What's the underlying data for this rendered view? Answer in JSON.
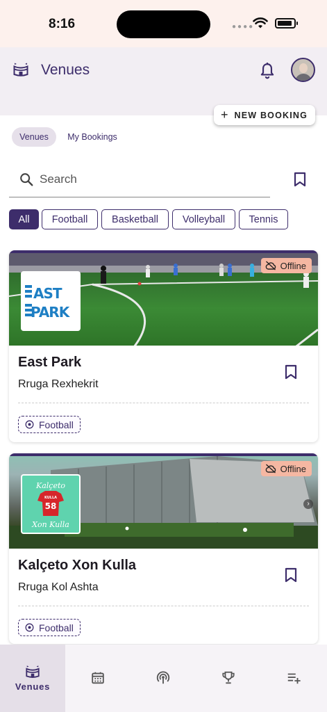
{
  "status_bar": {
    "time": "8:16"
  },
  "header": {
    "title": "Venues"
  },
  "new_booking": {
    "label": "NEW BOOKING"
  },
  "segments": [
    {
      "label": "Venues",
      "selected": true
    },
    {
      "label": "My Bookings",
      "selected": false
    }
  ],
  "search": {
    "placeholder": "Search",
    "value": ""
  },
  "filters": [
    {
      "label": "All",
      "selected": true
    },
    {
      "label": "Football",
      "selected": false
    },
    {
      "label": "Basketball",
      "selected": false
    },
    {
      "label": "Volleyball",
      "selected": false
    },
    {
      "label": "Tennis",
      "selected": false
    }
  ],
  "venues": [
    {
      "name": "East Park",
      "address": "Rruga Rexhekrit",
      "status": "Offline",
      "sport": "Football",
      "logo_text": [
        "EAST",
        "PARK"
      ]
    },
    {
      "name": "Kalçeto Xon Kulla",
      "address": "Rruga Kol Ashta",
      "status": "Offline",
      "sport": "Football",
      "logo_text": [
        "Kalçeto",
        "KULLA",
        "Xon Kulla"
      ]
    }
  ],
  "bottom_nav": [
    {
      "label": "Venues",
      "icon": "stadium-icon",
      "active": true
    },
    {
      "label": "",
      "icon": "calendar-icon",
      "active": false
    },
    {
      "label": "",
      "icon": "broadcast-icon",
      "active": false
    },
    {
      "label": "",
      "icon": "trophy-icon",
      "active": false
    },
    {
      "label": "",
      "icon": "playlist-add-icon",
      "active": false
    }
  ],
  "colors": {
    "primary": "#3d2d6b",
    "app_bar": "#f2eef3",
    "offline_badge": "#f5b7a2",
    "status_bar": "#fdf1ed"
  }
}
